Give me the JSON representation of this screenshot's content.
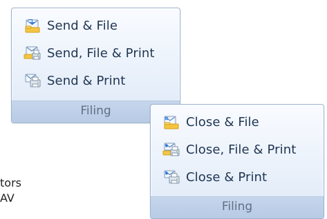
{
  "background": {
    "line_1": "tors",
    "line_2": "AV"
  },
  "groups": [
    {
      "title": "Filing",
      "items": [
        {
          "label": "Send & File",
          "icon_name": "send-file-icon"
        },
        {
          "label": "Send, File & Print",
          "icon_name": "send-file-print-icon"
        },
        {
          "label": "Send & Print",
          "icon_name": "send-print-icon"
        }
      ]
    },
    {
      "title": "Filing",
      "items": [
        {
          "label": "Close & File",
          "icon_name": "close-file-icon"
        },
        {
          "label": "Close, File & Print",
          "icon_name": "close-file-print-icon"
        },
        {
          "label": "Close & Print",
          "icon_name": "close-print-icon"
        }
      ]
    }
  ],
  "colors": {
    "group_border": "#9cb2d0",
    "group_footer": "#b8cbe5",
    "label_text": "#1f3552",
    "title_text": "#5f6f86"
  }
}
